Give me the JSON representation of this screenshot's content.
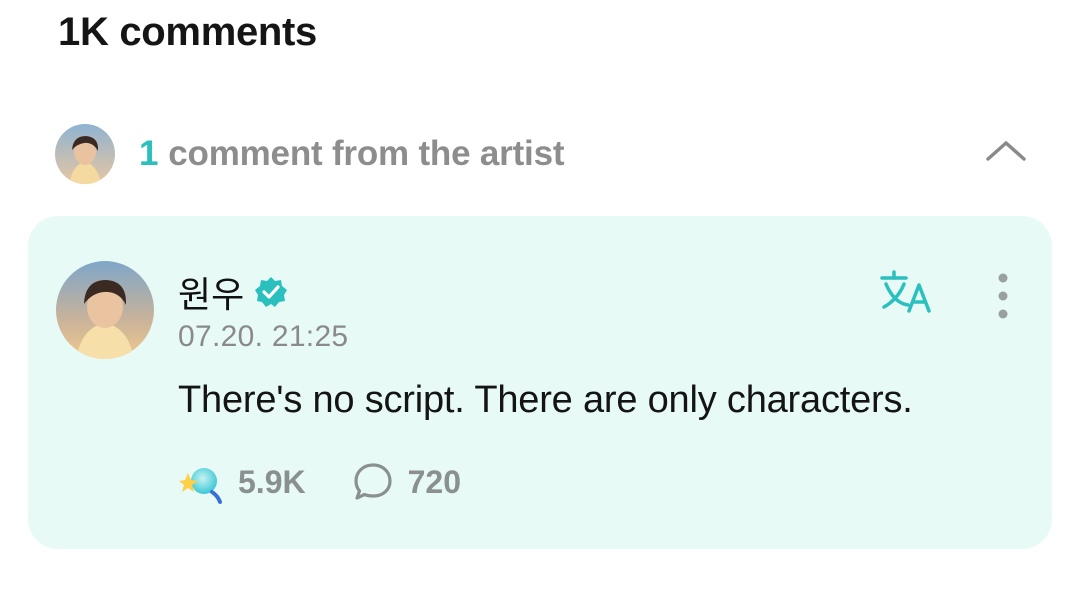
{
  "header": {
    "title": "1K comments"
  },
  "artist_section": {
    "count": "1",
    "label": "comment from the artist",
    "collapse_icon": "chevron-up-icon"
  },
  "comment": {
    "author": "원우",
    "verified_icon": "verified-badge-icon",
    "timestamp": "07.20. 21:25",
    "text": "There's no script. There are only characters.",
    "likes": "5.9K",
    "replies": "720",
    "translate_icon": "translate-icon",
    "more_icon": "more-vertical-icon"
  },
  "colors": {
    "accent": "#2bbfbd",
    "card_background": "#e7faf6",
    "muted_text": "#8a8a8a"
  }
}
